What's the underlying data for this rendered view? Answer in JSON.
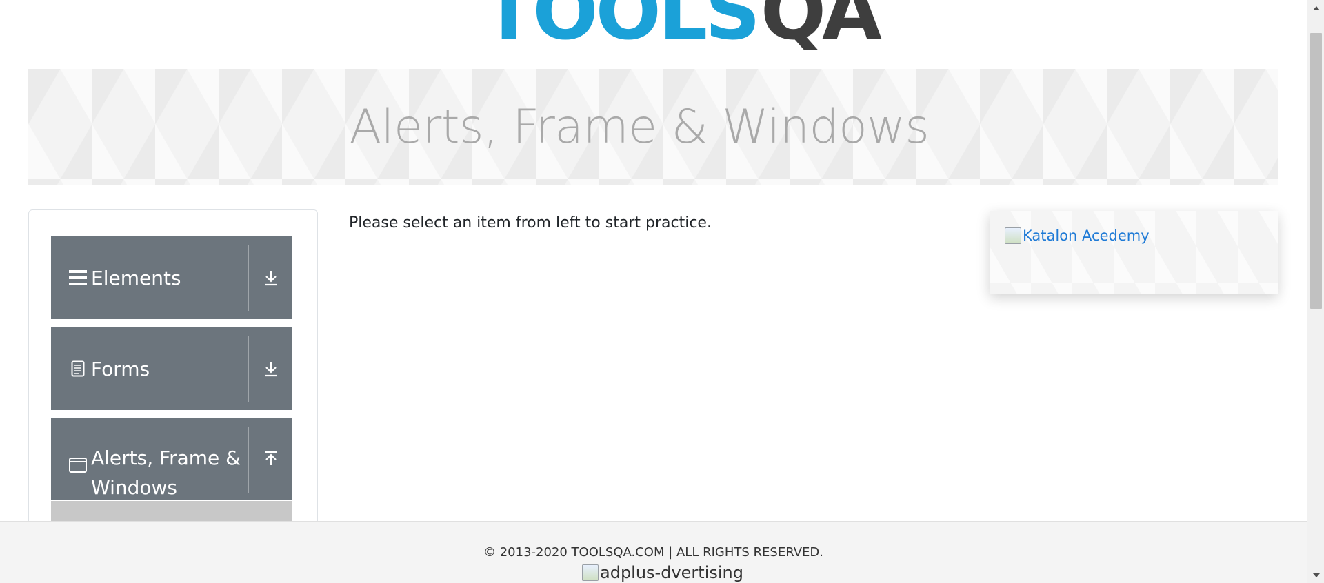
{
  "logo": {
    "text_tools": "TOOLS",
    "text_qa": "QA"
  },
  "banner": {
    "title": "Alerts, Frame & Windows"
  },
  "sidebar": {
    "groups": [
      {
        "label": "Elements",
        "icon": "hamburger-icon",
        "arrow": "download-arrow-icon"
      },
      {
        "label": "Forms",
        "icon": "document-icon",
        "arrow": "download-arrow-icon"
      },
      {
        "label": "Alerts, Frame & Windows",
        "icon": "window-icon",
        "arrow": "upload-arrow-icon"
      }
    ]
  },
  "main": {
    "instruction": "Please select an item from left to start practice."
  },
  "ad": {
    "alt_text": "Katalon Acedemy"
  },
  "footer": {
    "copyright": "© 2013-2020 TOOLSQA.COM | ALL RIGHTS RESERVED.",
    "ad_alt": "adplus-dvertising"
  },
  "colors": {
    "logo_blue": "#1ba1d8",
    "logo_dark": "#3e3e3e",
    "menu_bg": "#6c757d",
    "link": "#1e7ad6"
  }
}
